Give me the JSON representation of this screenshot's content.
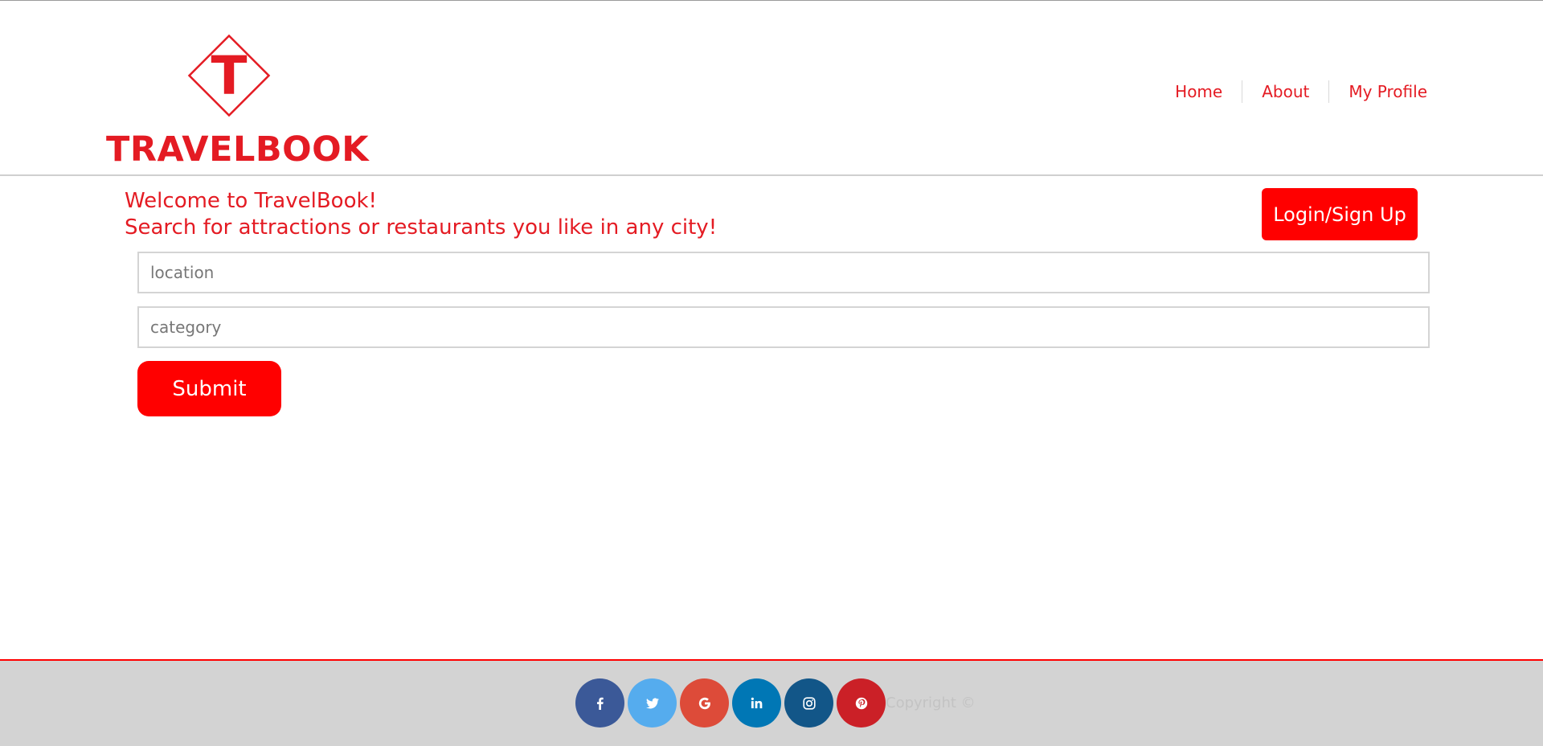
{
  "colors": {
    "brand": "#e41b23",
    "accent": "#ff0000",
    "footer_bg": "#d3d3d3"
  },
  "header": {
    "logo_letter": "T",
    "logo_text": "TRAVELBOOK",
    "nav": [
      {
        "label": "Home"
      },
      {
        "label": "About"
      },
      {
        "label": "My Profile"
      }
    ]
  },
  "main": {
    "welcome_line1": "Welcome to TravelBook!",
    "welcome_line2": "Search for attractions or restaurants you like in any city!",
    "login_label": "Login/Sign Up",
    "location_placeholder": "location",
    "category_placeholder": "category",
    "submit_label": "Submit"
  },
  "footer": {
    "social": [
      {
        "name": "facebook",
        "icon": "facebook-icon",
        "color": "#3b5998"
      },
      {
        "name": "twitter",
        "icon": "twitter-icon",
        "color": "#55acee"
      },
      {
        "name": "google",
        "icon": "google-icon",
        "color": "#dd4b39"
      },
      {
        "name": "linkedin",
        "icon": "linkedin-icon",
        "color": "#0077b5"
      },
      {
        "name": "instagram",
        "icon": "instagram-icon",
        "color": "#125688"
      },
      {
        "name": "pinterest",
        "icon": "pinterest-icon",
        "color": "#cb2027"
      }
    ],
    "copyright": "Copyright ©"
  }
}
